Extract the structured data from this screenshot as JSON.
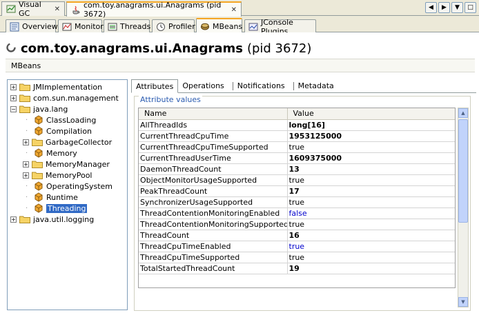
{
  "doc_tabs": [
    {
      "label": "Visual GC"
    },
    {
      "label": "com.toy.anagrams.ui.Anagrams (pid 3672)"
    }
  ],
  "sub_tabs": [
    {
      "label": "Overview"
    },
    {
      "label": "Monitor"
    },
    {
      "label": "Threads"
    },
    {
      "label": "Profiler"
    },
    {
      "label": "MBeans"
    },
    {
      "label": "JConsole Plugins"
    }
  ],
  "header": {
    "title": "com.toy.anagrams.ui.Anagrams",
    "pid": "(pid 3672)",
    "section": "MBeans"
  },
  "tree": {
    "items": [
      {
        "label": "JMImplementation"
      },
      {
        "label": "com.sun.management"
      },
      {
        "label": "java.lang"
      },
      {
        "label": "ClassLoading"
      },
      {
        "label": "Compilation"
      },
      {
        "label": "GarbageCollector"
      },
      {
        "label": "Memory"
      },
      {
        "label": "MemoryManager"
      },
      {
        "label": "MemoryPool"
      },
      {
        "label": "OperatingSystem"
      },
      {
        "label": "Runtime"
      },
      {
        "label": "Threading"
      },
      {
        "label": "java.util.logging"
      }
    ]
  },
  "attr_tabs": [
    {
      "label": "Attributes"
    },
    {
      "label": "Operations"
    },
    {
      "label": "Notifications"
    },
    {
      "label": "Metadata"
    }
  ],
  "attributes": {
    "legend": "Attribute values",
    "col_name": "Name",
    "col_value": "Value",
    "rows": [
      {
        "name": "AllThreadIds",
        "value": "long[16]"
      },
      {
        "name": "CurrentThreadCpuTime",
        "value": "1953125000"
      },
      {
        "name": "CurrentThreadCpuTimeSupported",
        "value": "true"
      },
      {
        "name": "CurrentThreadUserTime",
        "value": "1609375000"
      },
      {
        "name": "DaemonThreadCount",
        "value": "13"
      },
      {
        "name": "ObjectMonitorUsageSupported",
        "value": "true"
      },
      {
        "name": "PeakThreadCount",
        "value": "17"
      },
      {
        "name": "SynchronizerUsageSupported",
        "value": "true"
      },
      {
        "name": "ThreadContentionMonitoringEnabled",
        "value": "false"
      },
      {
        "name": "ThreadContentionMonitoringSupported",
        "value": "true"
      },
      {
        "name": "ThreadCount",
        "value": "16"
      },
      {
        "name": "ThreadCpuTimeEnabled",
        "value": "true"
      },
      {
        "name": "ThreadCpuTimeSupported",
        "value": "true"
      },
      {
        "name": "TotalStartedThreadCount",
        "value": "19"
      }
    ]
  },
  "colors": {
    "accent_tab": "#f5a623",
    "selection": "#316ac5",
    "legend_blue": "#2a5bb0",
    "editable_blue": "#0000cc"
  }
}
